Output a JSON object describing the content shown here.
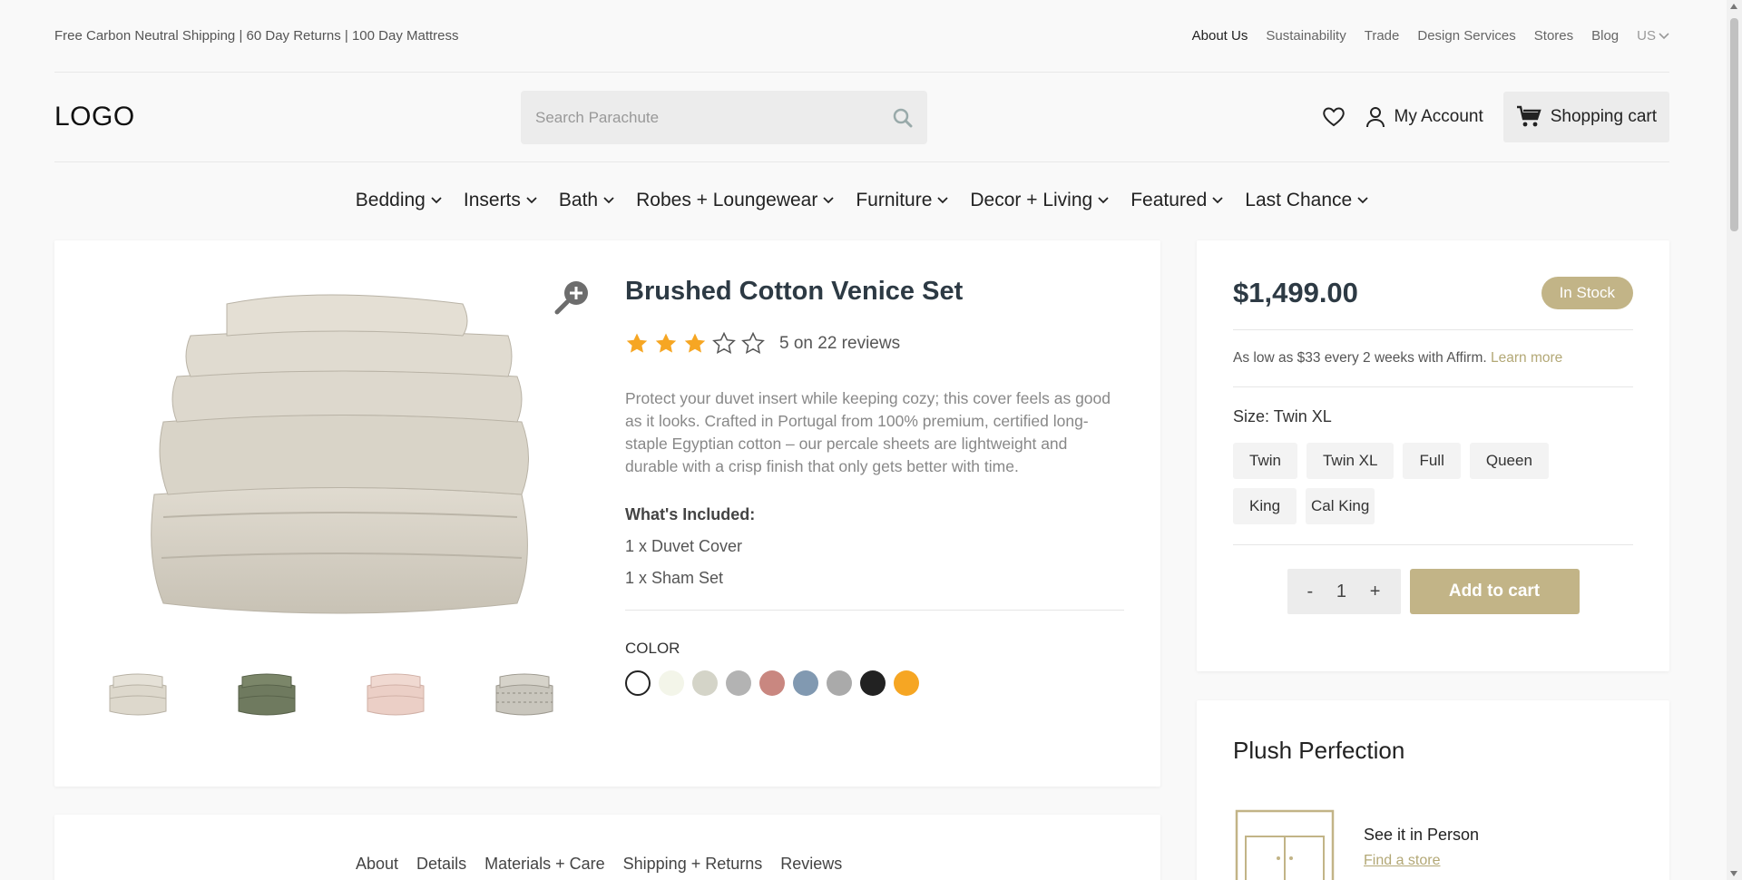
{
  "topbar": {
    "promo": "Free Carbon Neutral Shipping | 60 Day Returns | 100 Day Mattress",
    "links": [
      "About Us",
      "Sustainability",
      "Trade",
      "Design Services",
      "Stores",
      "Blog"
    ],
    "locale": "US"
  },
  "header": {
    "logo": "LOGO",
    "search_placeholder": "Search Parachute",
    "account_label": "My Account",
    "cart_label": "Shopping cart"
  },
  "nav": [
    "Bedding",
    "Inserts",
    "Bath",
    "Robes + Loungewear",
    "Furniture",
    "Decor + Living",
    "Featured",
    "Last Chance"
  ],
  "product": {
    "title": "Brushed Cotton Venice Set",
    "rating": 3,
    "rating_max": 5,
    "reviews_text": "5 on 22 reviews",
    "description": "Protect your duvet insert while keeping cozy; this cover feels as good as it looks. Crafted in Portugal from 100% premium, certified long-staple Egyptian cotton – our percale sheets are lightweight and durable with a crisp finish that only gets better with time.",
    "included_heading": "What's Included:",
    "included": [
      "1 x Duvet Cover",
      "1 x Sham Set"
    ],
    "color_heading": "COLOR",
    "colors": [
      "#ffffff",
      "#f3f5e9",
      "#d4d4c8",
      "#b3b3b3",
      "#c98780",
      "#8199b1",
      "#aaaaaa",
      "#222222",
      "#f6a623"
    ],
    "thumbnail_colors": [
      "#ddd8cc",
      "#6f7a5f",
      "#ebcfc6",
      "#c9c6bd"
    ]
  },
  "buybox": {
    "price": "$1,499.00",
    "stock": "In Stock",
    "affirm_text": "As low as $33 every 2 weeks with Affirm.",
    "affirm_link": "Learn more",
    "size_label": "Size: Twin XL",
    "sizes": [
      "Twin",
      "Twin XL",
      "Full",
      "Queen",
      "King",
      "Cal King"
    ],
    "qty_minus": "-",
    "qty_value": "1",
    "qty_plus": "+",
    "add_to_cart": "Add to cart"
  },
  "plush": {
    "title": "Plush Perfection",
    "see_title": "See it in Person",
    "find_link": "Find a store"
  },
  "tabs": [
    "About",
    "Details",
    "Materials + Care",
    "Shipping + Returns",
    "Reviews"
  ],
  "theme": {
    "accent": "#c2b487",
    "star": "#f6a623"
  }
}
